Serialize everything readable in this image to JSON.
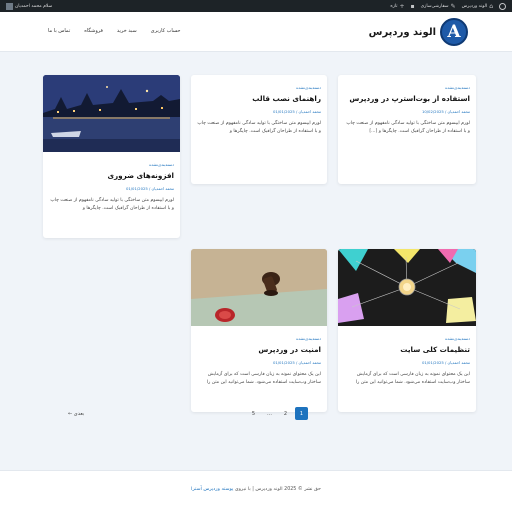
{
  "admin_bar": {
    "site_name": "الوند وردپرس",
    "customize": "سفارشی‌سازی",
    "new": "تازه",
    "greeting": "سلام محمد احمدیان"
  },
  "header": {
    "logo_letter": "A",
    "site_title": "الوند وردپرس",
    "nav": [
      "حساب کاربری",
      "سبد خرید",
      "فروشگاه",
      "تماس با ما"
    ]
  },
  "posts": [
    {
      "category": "دسته‌بندی‌نشده",
      "title": "استفاده از بوت‌استرپ در وردپرس",
      "meta": "محمد احمدیان / 10/02/2025",
      "excerpt": "لورم ایپسوم متن ساختگی با تولید سادگی نامفهوم از صنعت چاپ و با استفاده از طراحان گرافیک است. چاپگرها و [...]"
    },
    {
      "category": "دسته‌بندی‌نشده",
      "title": "راهنمای نصب قالب",
      "meta": "محمد احمدیان / 01/01/2025",
      "excerpt": "لورم ایپسوم متن ساختگی با تولید سادگی نامفهوم از صنعت چاپ و با استفاده از طراحان گرافیک است. چاپگرها و"
    },
    {
      "category": "دسته‌بندی‌نشده",
      "title": "افزونه‌های ضروری",
      "meta": "محمد احمدیان / 01/01/2025",
      "excerpt": "لورم ایپسوم متن ساختگی با تولید سادگی نامفهوم از صنعت چاپ و با استفاده از طراحان گرافیک است. چاپگرها و"
    },
    {
      "category": "دسته‌بندی‌نشده",
      "title": "تنظیمات کلی سایت",
      "meta": "محمد احمدیان / 01/01/2025",
      "excerpt": "این یک محتوای نمونه به زبان فارسی است که برای آزمایش ساختار وب‌سایت استفاده می‌شود. شما می‌توانید این متن را"
    },
    {
      "category": "دسته‌بندی‌نشده",
      "title": "امنیت در وردپرس",
      "meta": "محمد احمدیان / 01/01/2025",
      "excerpt": "این یک محتوای نمونه به زبان فارسی است که برای آزمایش ساختار وب‌سایت استفاده می‌شود. شما می‌توانید این متن را"
    }
  ],
  "pagination": {
    "pages": [
      "1",
      "2",
      "…",
      "5"
    ],
    "current": "1",
    "next": "بعدی ←"
  },
  "footer": {
    "text": "حق نشر © 2025 الوند وردپرس | با نیروی",
    "link": "پوسته وردپرس آسترا"
  },
  "colors": {
    "accent": "#1e73be",
    "admin_bar": "#1d2327",
    "background": "#f0f4f9"
  }
}
